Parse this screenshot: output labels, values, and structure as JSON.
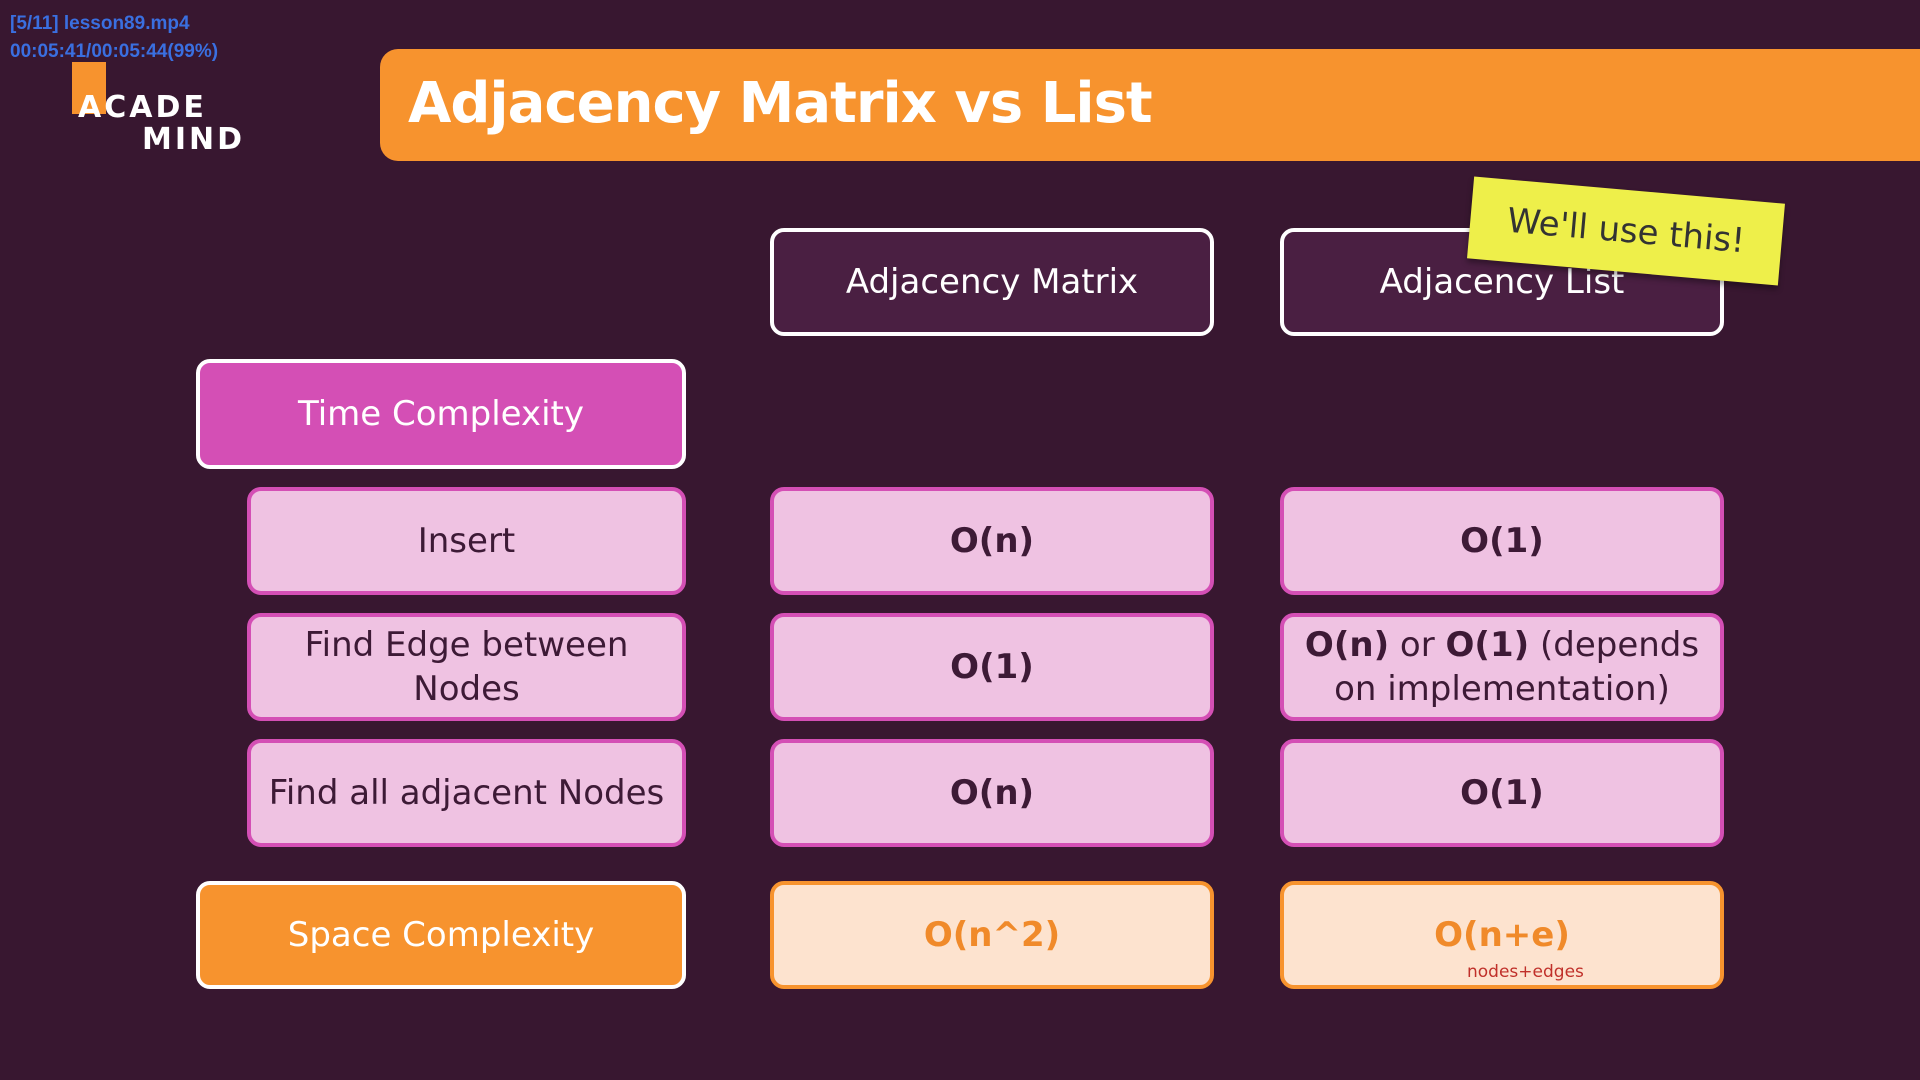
{
  "player": {
    "file_label": "[5/11] lesson89.mp4",
    "time_label": "00:05:41/00:05:44(99%)"
  },
  "logo": {
    "line1": "ACADE",
    "line2": "MIND"
  },
  "slide": {
    "title": "Adjacency Matrix vs List",
    "columns": {
      "matrix": "Adjacency Matrix",
      "list": "Adjacency List"
    },
    "sticker": "We'll use this!",
    "time_section": "Time Complexity",
    "space_section": "Space Complexity",
    "rows": [
      {
        "label": "Insert",
        "matrix": "O(n)",
        "list": "O(1)"
      },
      {
        "label_line1": "Find Edge between",
        "label_line2": "Nodes",
        "matrix": "O(1)",
        "list_part1": "O(n)",
        "list_part2": "or",
        "list_part3": "O(1)",
        "list_part4": "(depends",
        "list_part5": "on implementation)"
      },
      {
        "label": "Find all adjacent Nodes",
        "matrix": "O(n)",
        "list": "O(1)"
      }
    ],
    "space": {
      "matrix": "O(n^2)",
      "list": "O(n+e)",
      "list_note": "nodes+edges"
    }
  },
  "colors": {
    "background": "#381730",
    "accent_orange": "#f7932e",
    "accent_pink": "#d44fb5",
    "cell_pink": "#efc2e2",
    "cell_peach": "#fde3cf",
    "sticker_yellow": "#eeef4a"
  }
}
